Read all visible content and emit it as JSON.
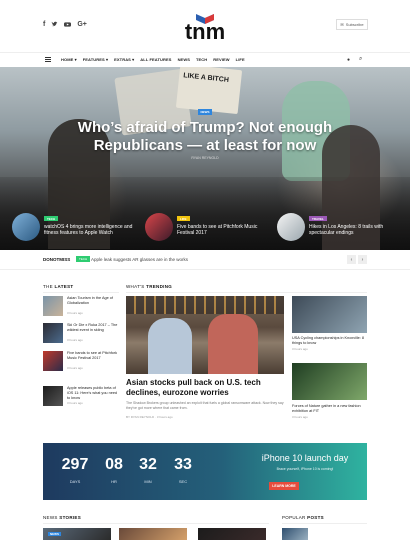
{
  "header": {
    "logo_text": "tnm",
    "social": [
      "f",
      "t",
      "yt",
      "G+"
    ],
    "subscribe_label": "Subscribe"
  },
  "nav": {
    "items": [
      "HOME ▾",
      "FEATURES ▾",
      "EXTRAS ▾",
      "ALL FEATURES",
      "NEWS",
      "TECH",
      "REVIEW",
      "LIFE"
    ]
  },
  "hero": {
    "badge": "NEWS",
    "title": "Who’s afraid of Trump? Not enough Republicans — at least for now",
    "author": "RYAN REYNOLD",
    "sign_text": "LIKE A BITCH",
    "cards": [
      {
        "tag": "TECH",
        "tag_color": "#2ecc71",
        "text": "watchOS 4 brings more intelligence and fitness features to Apple Watch"
      },
      {
        "tag": "LIFE",
        "tag_color": "#f1c40f",
        "text": "Five bands to see at Pitchfork Music Festival 2017"
      },
      {
        "tag": "TRAVEL",
        "tag_color": "#9b59b6",
        "text": "Hikes in Los Angeles: 8 trails with spectacular endings"
      }
    ]
  },
  "ticker": {
    "label": "DONOTMISS",
    "badge": "TECH",
    "text": "Apple leak suggests AR glasses are in the works"
  },
  "latest": {
    "heading_prefix": "THE",
    "heading_bold": "LATEST",
    "items": [
      {
        "title": "Asian Tourism in the Age of Globalization",
        "meta": "3 hours ago"
      },
      {
        "title": "Ski Or Die x Ruka 2017 – The wildest event in skiing",
        "meta": "3 hours ago"
      },
      {
        "title": "Five bands to see at Pitchfork Music Festival 2017",
        "meta": "3 hours ago"
      },
      {
        "title": "Apple releases public beta of iOS 11: Here's what you need to know",
        "meta": "3 hours ago"
      }
    ]
  },
  "trending": {
    "heading_prefix": "WHAT'S",
    "heading_bold": "TRENDING",
    "main_title": "Asian stocks pull back on U.S. tech declines, eurozone worries",
    "main_excerpt": "The Shadow Brokers group unleashed an exploit that fuels a global ransomware attack. Now they say they've got more where that came from.",
    "main_meta": "BY RYAN REYNOLD · 3 hours ago",
    "side": [
      {
        "title": "USA Cycling championships in Knoxville: 8 things to know",
        "meta": "3 hours ago"
      },
      {
        "title": "Forces of Nature gather in a new fashion exhibition at FIT",
        "meta": "3 hours ago"
      }
    ]
  },
  "countdown": {
    "days": "297",
    "days_label": "DAYS",
    "hours": "08",
    "hours_label": "HR",
    "mins": "32",
    "mins_label": "MIN",
    "secs": "33",
    "secs_label": "SEC",
    "title": "iPhone 10 launch day",
    "subtitle": "Brace yourself, iPhone 10 is coming!",
    "button": "LEARN MORE"
  },
  "bottom": {
    "news_prefix": "NEWS",
    "news_bold": "STORIES",
    "popular_prefix": "POPULAR",
    "popular_bold": "POSTS",
    "news_badge": "NEWS"
  }
}
